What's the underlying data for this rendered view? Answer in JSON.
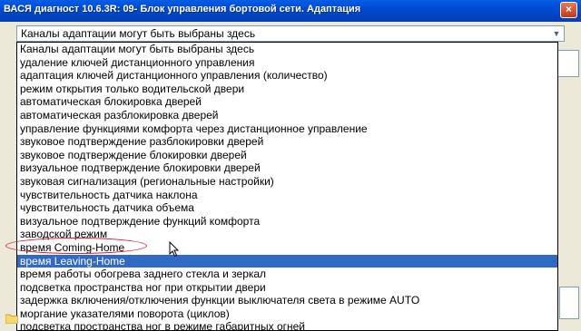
{
  "window": {
    "title": "ВАСЯ диагност 10.6.3R: 09- Блок управления бортовой сети. Адаптация",
    "close_label": "×"
  },
  "combo": {
    "selected_value": "Каналы адаптации могут быть выбраны здесь",
    "dropdown_icon": "chevron-down-icon"
  },
  "list": {
    "selected_index": 16,
    "items": [
      "Каналы адаптации могут быть выбраны здесь",
      "удаление ключей дистанционного управления",
      "адаптация ключей дистанционного управления (количество)",
      "режим открытия только водительской двери",
      "автоматическая блокировка дверей",
      "автоматическая разблокировка дверей",
      "управление функциями комфорта через дистанционное управление",
      "звуковое подтверждение разблокировки дверей",
      "звуковое подтверждение блокировки дверей",
      "визуальное подтверждение блокировки дверей",
      "звуковая сигнализация (региональные настройки)",
      "чувствительность датчика наклона",
      "чувствительность датчика объема",
      "визуальное подтверждение функций комфорта",
      "заводской режим",
      "время Coming-Home",
      "время Leaving-Home",
      "время работы обогрева заднего стекла и зеркал",
      "подсветка пространства ног при открытии двери",
      "задержка включения/отключения функции выключателя света в режиме AUTO",
      "моргание указателями поворота (циклов)",
      "подсветка пространства ног в режиме габаритных огней"
    ]
  },
  "colors": {
    "selection": "#316ac5",
    "annotation_ellipse": "#d4243e",
    "titlebar": "#0149cf"
  }
}
